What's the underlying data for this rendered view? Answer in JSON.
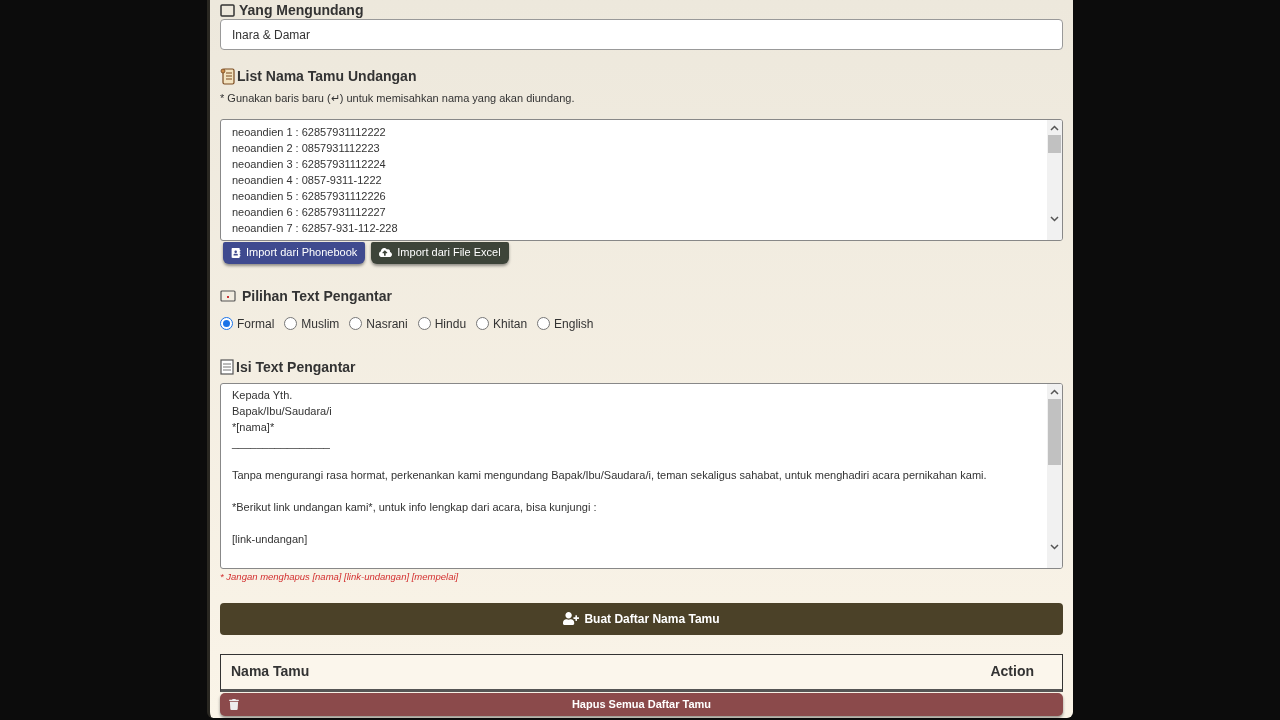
{
  "inviter": {
    "label": "Yang Mengundang",
    "value": "Inara & Damar"
  },
  "guest_list": {
    "title": "List Nama Tamu Undangan",
    "note": "* Gunakan baris baru (↵) untuk memisahkan nama yang akan diundang.",
    "lines": [
      "neoandien 1 : 62857931112222",
      "neoandien 2 : 0857931112223",
      "neoandien 3 : 62857931112224",
      "neoandien 4 : 0857-9311-1222",
      "neoandien 5 : 62857931112226",
      "neoandien 6 : 62857931112227",
      "neoandien 7 : 62857-931-112-228"
    ],
    "buttons": [
      {
        "kind": "phonebook",
        "label": "Import dari Phonebook"
      },
      {
        "kind": "excel",
        "label": "Import dari File Excel"
      }
    ]
  },
  "intro_choice": {
    "title": "Pilihan Text Pengantar",
    "options": [
      {
        "label": "Formal",
        "selected": true
      },
      {
        "label": "Muslim",
        "selected": false
      },
      {
        "label": "Nasrani",
        "selected": false
      },
      {
        "label": "Hindu",
        "selected": false
      },
      {
        "label": "Khitan",
        "selected": false
      },
      {
        "label": "English",
        "selected": false
      }
    ]
  },
  "intro_text": {
    "title": "Isi Text Pengantar",
    "paragraphs": [
      [
        "Kepada Yth.",
        "Bapak/Ibu/Saudara/i",
        "*[nama]*",
        "________________"
      ],
      [
        "Tanpa mengurangi rasa hormat, perkenankan kami mengundang Bapak/Ibu/Saudara/i, teman sekaligus sahabat, untuk menghadiri acara pernikahan kami."
      ],
      [
        "*Berikut link undangan kami*, untuk info lengkap dari acara, bisa kunjungi :"
      ],
      [
        "[link-undangan]"
      ]
    ],
    "warning": "* Jangan menghapus [nama] [link-undangan] [mempelai]"
  },
  "create_button": "Buat Daftar Nama Tamu",
  "table": {
    "columns": [
      "Nama Tamu",
      "Action"
    ]
  },
  "delete_all_button": "Hapus Semua Daftar Tamu"
}
